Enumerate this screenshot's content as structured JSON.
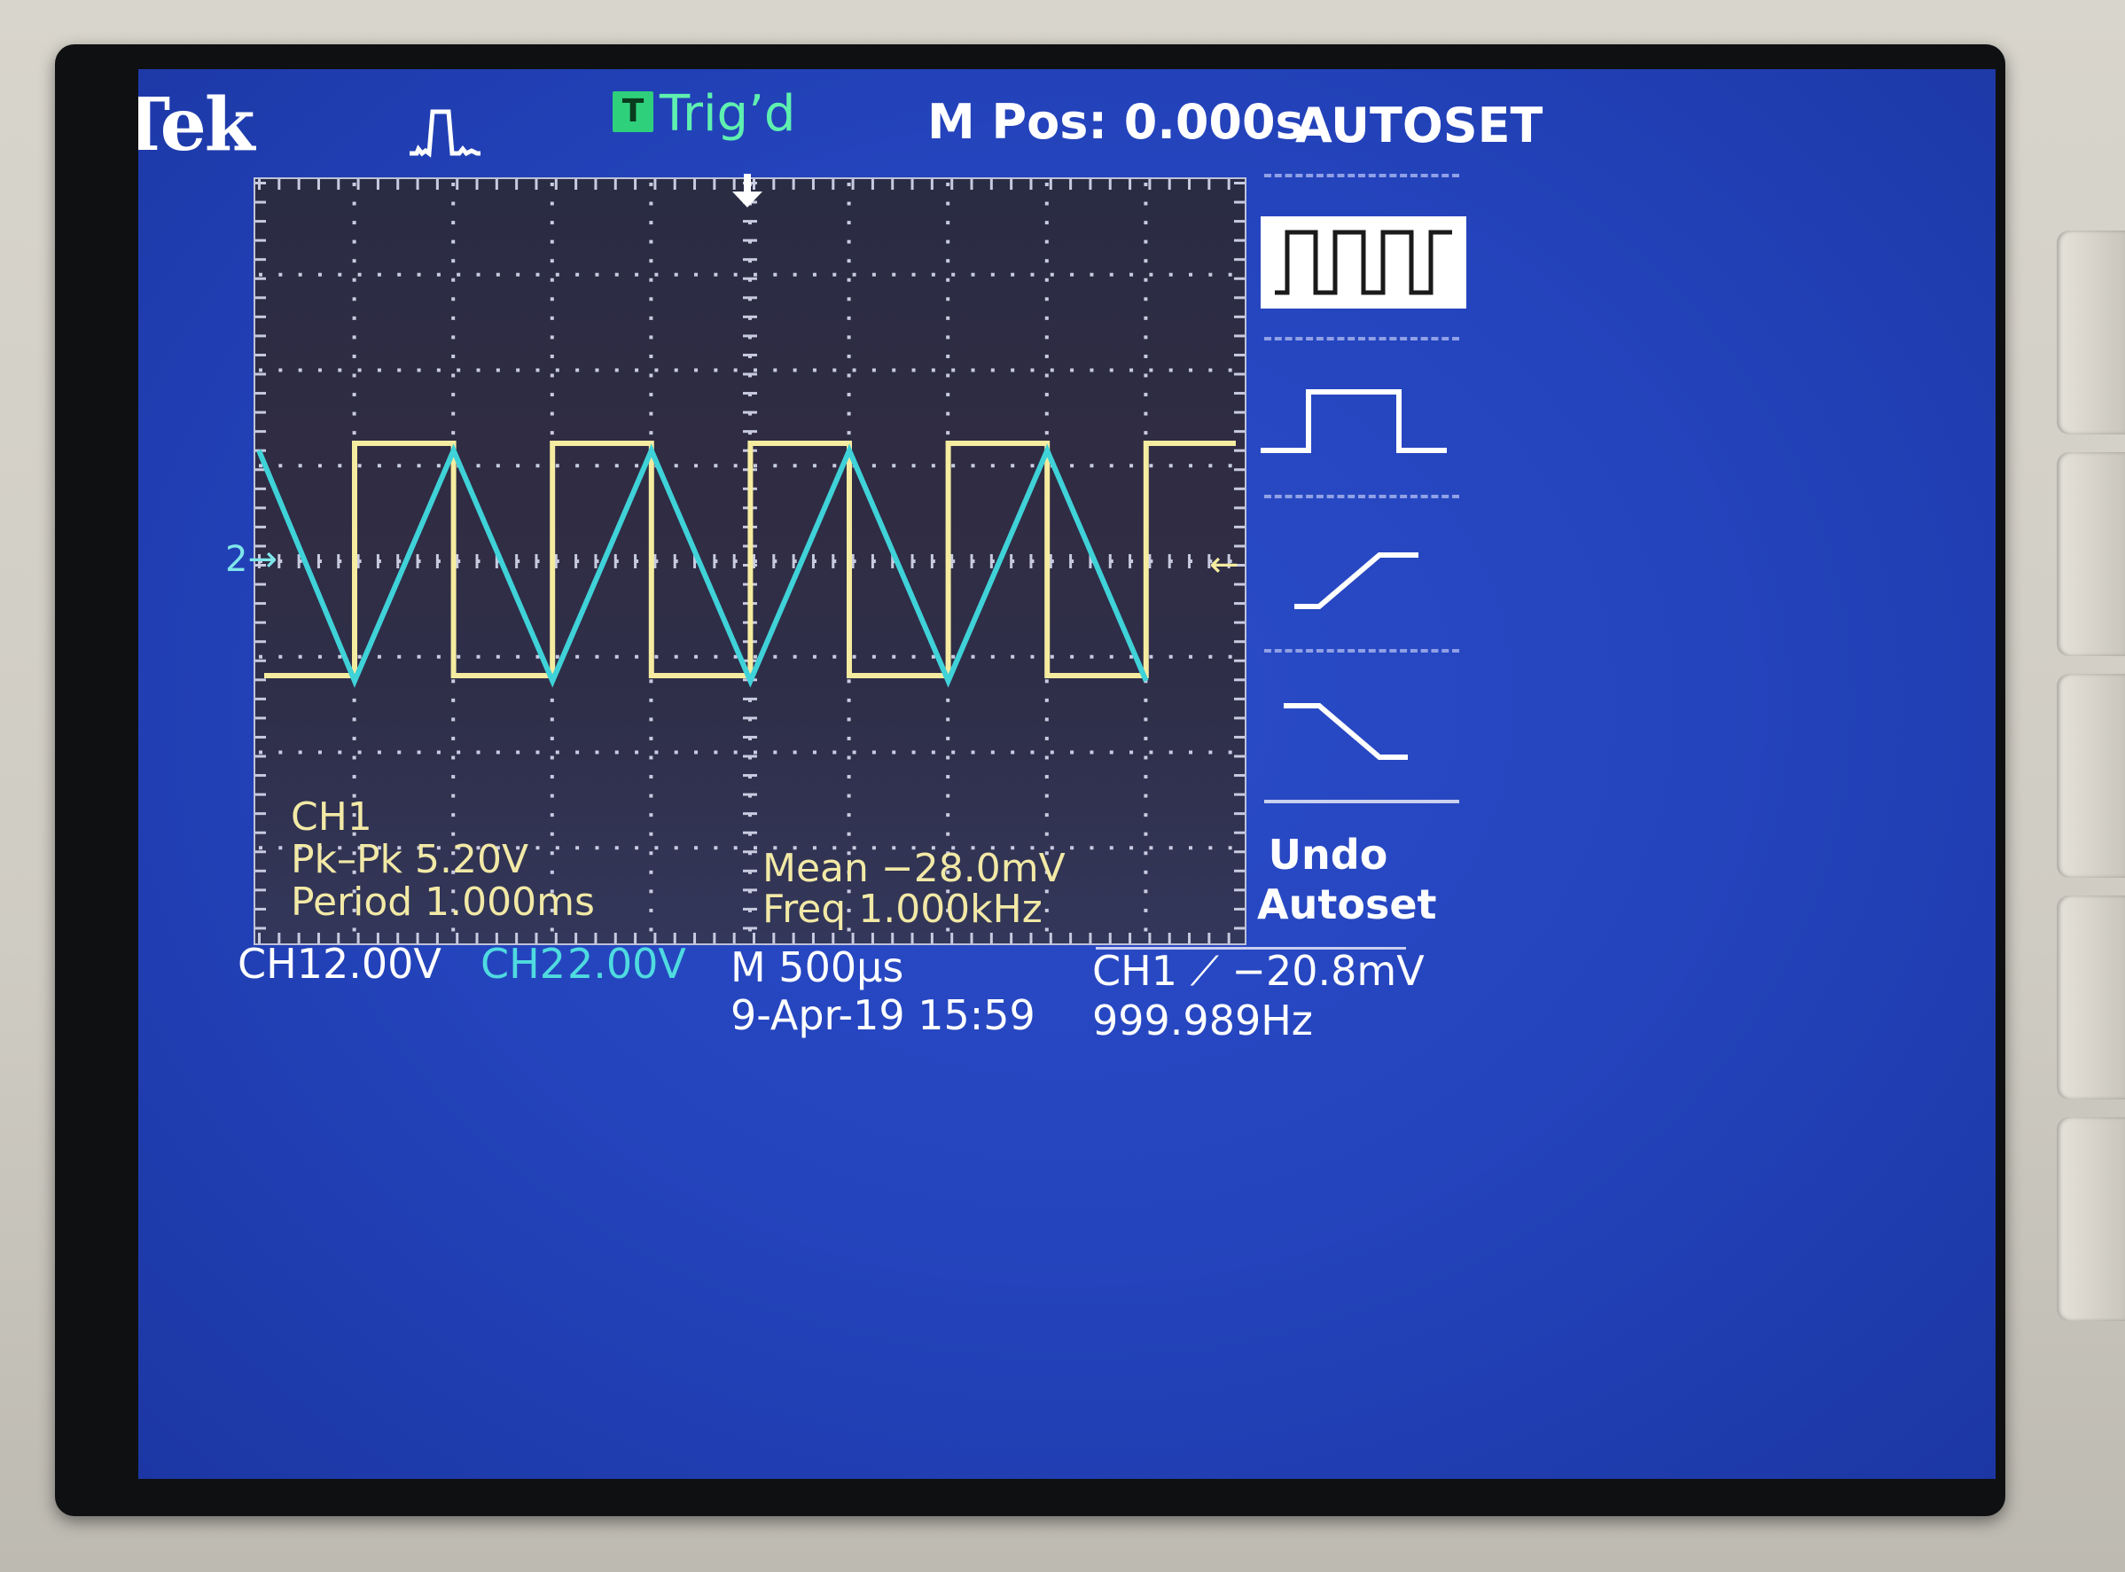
{
  "header": {
    "brand": "Tek",
    "trigger_badge": "T",
    "trigger_status": "Trig’d",
    "horizontal_position": "M Pos: 0.000s",
    "menu_title": "AUTOSET"
  },
  "channel_markers": {
    "ch2_marker": "2",
    "ch2_arrow": "→",
    "trigger_level_arrow": "←"
  },
  "measurements": {
    "channel": "CH1",
    "pk_pk": "Pk–Pk 5.20V",
    "period": "Period 1.000ms",
    "mean": "Mean −28.0mV",
    "freq": "Freq 1.000kHz"
  },
  "status_bar": {
    "ch1_label": "CH1",
    "ch1_scale": "2.00V",
    "ch2_label": "CH2",
    "ch2_scale": "2.00V",
    "timebase": "M 500µs",
    "trigger_readout": "CH1 ⟋ −20.8mV",
    "datetime": "9-Apr-19 15:59",
    "trigger_frequency": "999.989Hz"
  },
  "menu": {
    "undo_label": "Undo\nAutoset",
    "options": [
      "multi-cycle-square-icon",
      "single-pulse-icon",
      "rising-edge-icon",
      "falling-edge-icon"
    ],
    "selected_option": "multi-cycle-square-icon"
  },
  "colors": {
    "ch1": "#f5eca0",
    "ch2": "#3fd2d8",
    "screen": "#2444bd",
    "graticule_bg": "#2f2d46"
  }
}
